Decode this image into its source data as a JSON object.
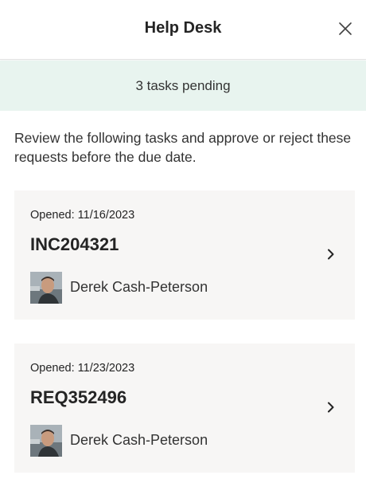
{
  "header": {
    "title": "Help Desk",
    "close_icon": "close-icon"
  },
  "banner": {
    "text": "3 tasks pending",
    "color": "#e8f4ef"
  },
  "description": "Review the following tasks and approve or reject these requests before the due date.",
  "tasks": [
    {
      "opened": "Opened: 11/16/2023",
      "id": "INC204321",
      "assignee": "Derek Cash-Peterson",
      "chevron_icon": "chevron-right-icon"
    },
    {
      "opened": "Opened: 11/23/2023",
      "id": "REQ352496",
      "assignee": "Derek Cash-Peterson",
      "chevron_icon": "chevron-right-icon"
    }
  ]
}
